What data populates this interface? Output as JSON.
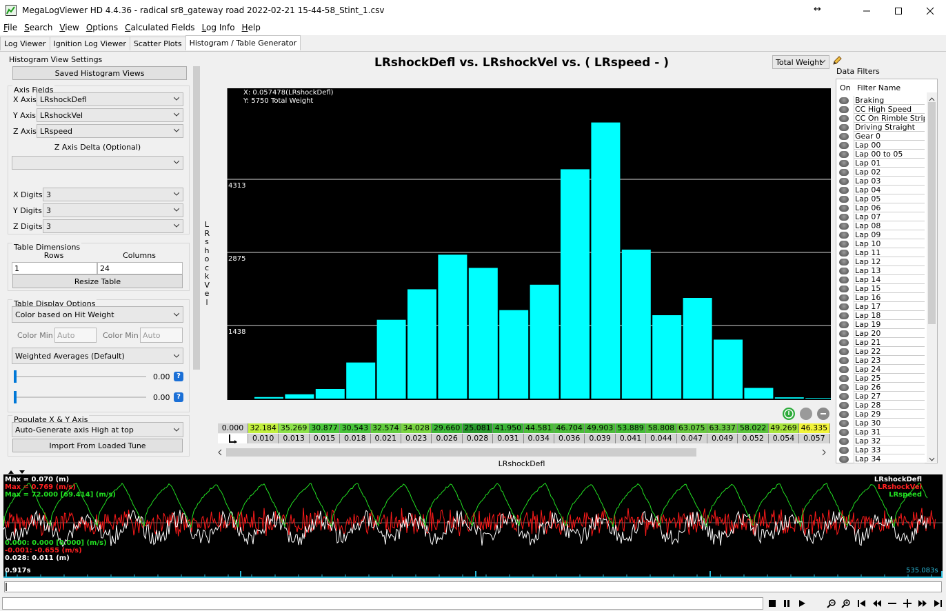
{
  "window": {
    "title": "MegaLogViewer HD 4.4.36 - radical sr8_gateway road 2022-02-21 15-44-58_Stint_1.csv",
    "resize_glyph": "↔"
  },
  "menu": [
    {
      "first": "F",
      "rest": "ile"
    },
    {
      "first": "S",
      "rest": "earch"
    },
    {
      "first": "V",
      "rest": "iew"
    },
    {
      "first": "O",
      "rest": "ptions"
    },
    {
      "first": "C",
      "rest": "alculated Fields"
    },
    {
      "first": "L",
      "rest": "og Info"
    },
    {
      "first": "H",
      "rest": "elp"
    }
  ],
  "tabs": [
    "Log Viewer",
    "Ignition Log Viewer",
    "Scatter Plots",
    "Histogram / Table Generator"
  ],
  "left": {
    "section_title": "Histogram View Settings",
    "saved_views_label": "Saved Histogram Views",
    "axis_fields_title": "Axis Fields",
    "x_axis_label": "X Axis:",
    "x_axis_value": "LRshockDefl",
    "y_axis_label": "Y Axis:",
    "y_axis_value": "LRshockVel",
    "z_axis_label": "Z Axis:",
    "z_axis_value": "LRspeed",
    "z_delta_label": "Z Axis Delta (Optional)",
    "z_delta_value": "",
    "x_digits_label": "X Digits:",
    "x_digits_value": "3",
    "y_digits_label": "Y Digits:",
    "y_digits_value": "3",
    "z_digits_label": "Z Digits:",
    "z_digits_value": "3",
    "table_dimensions_title": "Table Dimensions",
    "rows_label": "Rows",
    "rows_value": "1",
    "columns_label": "Columns",
    "columns_value": "24",
    "resize_label": "Resize Table",
    "display_options_title": "Table Display Options",
    "color_mode": "Color based on Hit Weight",
    "color_min_label": "Color Min",
    "color_min_placeholder": "Auto",
    "color_max_label": "Color Min",
    "color_max_placeholder": "Auto",
    "average_mode": "Weighted Averages (Default)",
    "slider1_value": "0.00",
    "slider2_value": "0.00",
    "populate_title": "Populate X & Y Axis",
    "populate_mode": "Auto-Generate axis High at top",
    "import_label": "Import From Loaded Tune",
    "info_glyph": "?"
  },
  "chart": {
    "title": "LRshockDefl vs. LRshockVel vs. ( LRspeed -   )",
    "weight_mode": "Total Weight",
    "readout_x": "X: 0.057478(LRshockDefl)",
    "readout_y": "Y: 5750 Total Weight",
    "y_axis_title": "LRshockVel",
    "x_axis_title": "LRshockDefl"
  },
  "chart_data": {
    "type": "bar",
    "title": "LRshockDefl vs. LRshockVel vs. ( LRspeed -   )",
    "xlabel": "LRshockDefl",
    "ylabel": "LRshockVel",
    "ylim": [
      0,
      5750
    ],
    "yticks": [
      1438,
      2875,
      4313
    ],
    "categories": [
      "0.010",
      "0.013",
      "0.015",
      "0.018",
      "0.021",
      "0.023",
      "0.026",
      "0.028",
      "0.031",
      "0.034",
      "0.036",
      "0.039",
      "0.041",
      "0.044",
      "0.047",
      "0.049",
      "0.052",
      "0.054",
      "0.057"
    ],
    "values": [
      30,
      85,
      190,
      710,
      1550,
      2150,
      2830,
      2570,
      1740,
      2240,
      4510,
      5430,
      2930,
      1640,
      1980,
      1160,
      210,
      25,
      12
    ],
    "grid": true
  },
  "table": {
    "corner_value": "0.000",
    "averages": [
      "32.184",
      "35.269",
      "30.877",
      "30.543",
      "32.574",
      "34.028",
      "29.660",
      "25.081",
      "41.950",
      "44.581",
      "46.704",
      "49.903",
      "53.889",
      "58.808",
      "63.075",
      "63.337",
      "58.022",
      "49.269",
      "46.335"
    ],
    "axis": [
      "0.010",
      "0.013",
      "0.015",
      "0.018",
      "0.021",
      "0.023",
      "0.026",
      "0.028",
      "0.031",
      "0.034",
      "0.036",
      "0.039",
      "0.041",
      "0.044",
      "0.047",
      "0.049",
      "0.052",
      "0.054",
      "0.057"
    ],
    "colors": [
      "#c2f03e",
      "#8ce24a",
      "#4cc83c",
      "#48c43a",
      "#62cc3e",
      "#7ad642",
      "#3eb838",
      "#2a9a2e",
      "#3cb438",
      "#4cbc3a",
      "#4cbc3a",
      "#4cbc3a",
      "#46bc38",
      "#54c03c",
      "#68c840",
      "#6ac842",
      "#5ac43c",
      "#a8e43c",
      "#f2f43a"
    ]
  },
  "filters": {
    "title": "Data Filters",
    "col_on": "On",
    "col_name": "Filter Name",
    "items": [
      "Braking",
      "CC High Speed",
      "CC On Rimble Strips",
      "Driving Straight",
      "Gear 0",
      "Lap 00",
      "Lap 00 to 05",
      "Lap 01",
      "Lap 02",
      "Lap 03",
      "Lap 04",
      "Lap 05",
      "Lap 06",
      "Lap 07",
      "Lap 08",
      "Lap 09",
      "Lap 10",
      "Lap 11",
      "Lap 12",
      "Lap 13",
      "Lap 14",
      "Lap 15",
      "Lap 16",
      "Lap 17",
      "Lap 18",
      "Lap 19",
      "Lap 20",
      "Lap 21",
      "Lap 22",
      "Lap 23",
      "Lap 24",
      "Lap 25",
      "Lap 26",
      "Lap 27",
      "Lap 28",
      "Lap 29",
      "Lap 30",
      "Lap 31",
      "Lap 32",
      "Lap 33",
      "Lap 34"
    ]
  },
  "graph": {
    "max_lines": [
      {
        "text": "Max = 0.070 (m)",
        "color": "#ffffff"
      },
      {
        "text": "Max = 0.769 (m/s)",
        "color": "#ff2020"
      },
      {
        "text": "Max = 72.000 [69.414] (m/s)",
        "color": "#22e022"
      }
    ],
    "min_lines": [
      {
        "text": "0.000: 0.000 [0.000] (m/s)",
        "color": "#22e022"
      },
      {
        "text": "-0.001: -0.655 (m/s)",
        "color": "#ff2020"
      },
      {
        "text": "0.028: 0.011 (m)",
        "color": "#ffffff"
      }
    ],
    "legend": [
      {
        "text": "LRshockDefl",
        "color": "#ffffff"
      },
      {
        "text": "LRshockVel",
        "color": "#ff2020"
      },
      {
        "text": "LRspeed",
        "color": "#22e022"
      }
    ],
    "time_start": "0.917s",
    "time_end": "535.083s"
  }
}
